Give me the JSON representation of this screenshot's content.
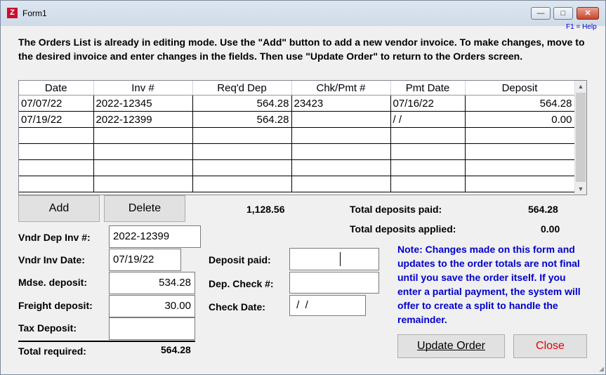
{
  "window": {
    "title": "Form1",
    "icon": "app-logo-icon"
  },
  "help_hint": "F1 = Help",
  "instructions": "The Orders List is already in editing mode. Use the \"Add\" button to add a new vendor invoice. To make changes, move to the desired invoice and enter changes in the fields. Then use \"Update Order\" to return to the Orders screen.",
  "grid": {
    "columns": [
      "Date",
      "Inv #",
      "Req'd Dep",
      "Chk/Pmt #",
      "Pmt Date",
      "Deposit"
    ],
    "rows": [
      [
        "07/07/22",
        "2022-12345",
        "564.28",
        "23423",
        "07/16/22",
        "564.28"
      ],
      [
        "07/19/22",
        "2022-12399",
        "564.28",
        "",
        "/ /",
        "0.00"
      ]
    ],
    "empty_rows": 4
  },
  "buttons": {
    "add": "Add",
    "delete": "Delete",
    "update": "Update Order",
    "close": "Close"
  },
  "req_total": "1,128.56",
  "summary": {
    "paid_label": "Total deposits paid:",
    "paid_value": "564.28",
    "applied_label": "Total deposits applied:",
    "applied_value": "0.00"
  },
  "fields": {
    "vndr_dep_inv": {
      "label": "Vndr Dep Inv #:",
      "value": "2022-12399"
    },
    "vndr_inv_date": {
      "label": "Vndr Inv Date:",
      "value": "07/19/22"
    },
    "mdse_deposit": {
      "label": "Mdse. deposit:",
      "value": "534.28"
    },
    "freight_deposit": {
      "label": "Freight deposit:",
      "value": "30.00"
    },
    "tax_deposit": {
      "label": "Tax Deposit:",
      "value": ""
    },
    "total_required": {
      "label": "Total required:",
      "value": "564.28"
    },
    "deposit_paid": {
      "label": "Deposit paid:",
      "value": ""
    },
    "dep_check": {
      "label": "Dep. Check #:",
      "value": ""
    },
    "check_date": {
      "label": "Check Date:",
      "value": " /  /"
    }
  },
  "note": "Note: Changes made on this form and updates to the order totals are not final until you save the order itself.  If you enter a partial payment, the system will offer to create a split to handle the remainder.",
  "colors": {
    "note_text": "#0000cc",
    "close_text": "#e00000"
  }
}
